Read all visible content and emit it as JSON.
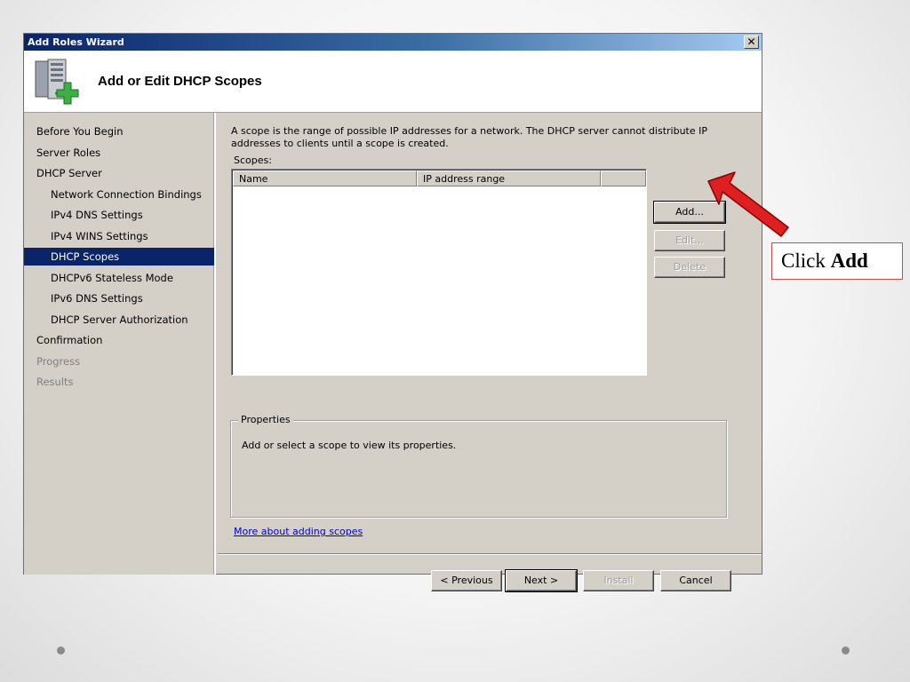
{
  "window": {
    "title": "Add Roles Wizard",
    "close_glyph": "✕"
  },
  "header": {
    "title": "Add or Edit DHCP Scopes",
    "icon": "server-add-icon"
  },
  "nav": {
    "items": [
      {
        "label": "Before You Begin",
        "level": "top",
        "state": "normal"
      },
      {
        "label": "Server Roles",
        "level": "top",
        "state": "normal"
      },
      {
        "label": "DHCP Server",
        "level": "top",
        "state": "normal"
      },
      {
        "label": "Network Connection Bindings",
        "level": "sub",
        "state": "normal"
      },
      {
        "label": "IPv4 DNS Settings",
        "level": "sub",
        "state": "normal"
      },
      {
        "label": "IPv4 WINS Settings",
        "level": "sub",
        "state": "normal"
      },
      {
        "label": "DHCP Scopes",
        "level": "sub",
        "state": "selected"
      },
      {
        "label": "DHCPv6 Stateless Mode",
        "level": "sub",
        "state": "normal"
      },
      {
        "label": "IPv6 DNS Settings",
        "level": "sub",
        "state": "normal"
      },
      {
        "label": "DHCP Server Authorization",
        "level": "sub",
        "state": "normal"
      },
      {
        "label": "Confirmation",
        "level": "top",
        "state": "normal"
      },
      {
        "label": "Progress",
        "level": "top",
        "state": "disabled"
      },
      {
        "label": "Results",
        "level": "top",
        "state": "disabled"
      }
    ]
  },
  "content": {
    "description": "A scope is the range of possible IP addresses for a network. The DHCP server cannot distribute IP addresses to clients until a scope is created.",
    "scopes_label": "Scopes:",
    "columns": [
      "Name",
      "IP address range"
    ],
    "buttons": {
      "add": "Add...",
      "edit": "Edit...",
      "delete": "Delete"
    },
    "properties": {
      "legend": "Properties",
      "text": "Add or select a scope to view its properties."
    },
    "link": "More about adding scopes"
  },
  "footer": {
    "previous": "< Previous",
    "next": "Next >",
    "install": "Install",
    "cancel": "Cancel"
  },
  "annotation": {
    "text_prefix": "Click ",
    "text_bold": "Add",
    "color": "#e02020"
  },
  "colors": {
    "selection": "#0a246a",
    "dialog_bg": "#d4d0c8",
    "link": "#0000cc"
  }
}
